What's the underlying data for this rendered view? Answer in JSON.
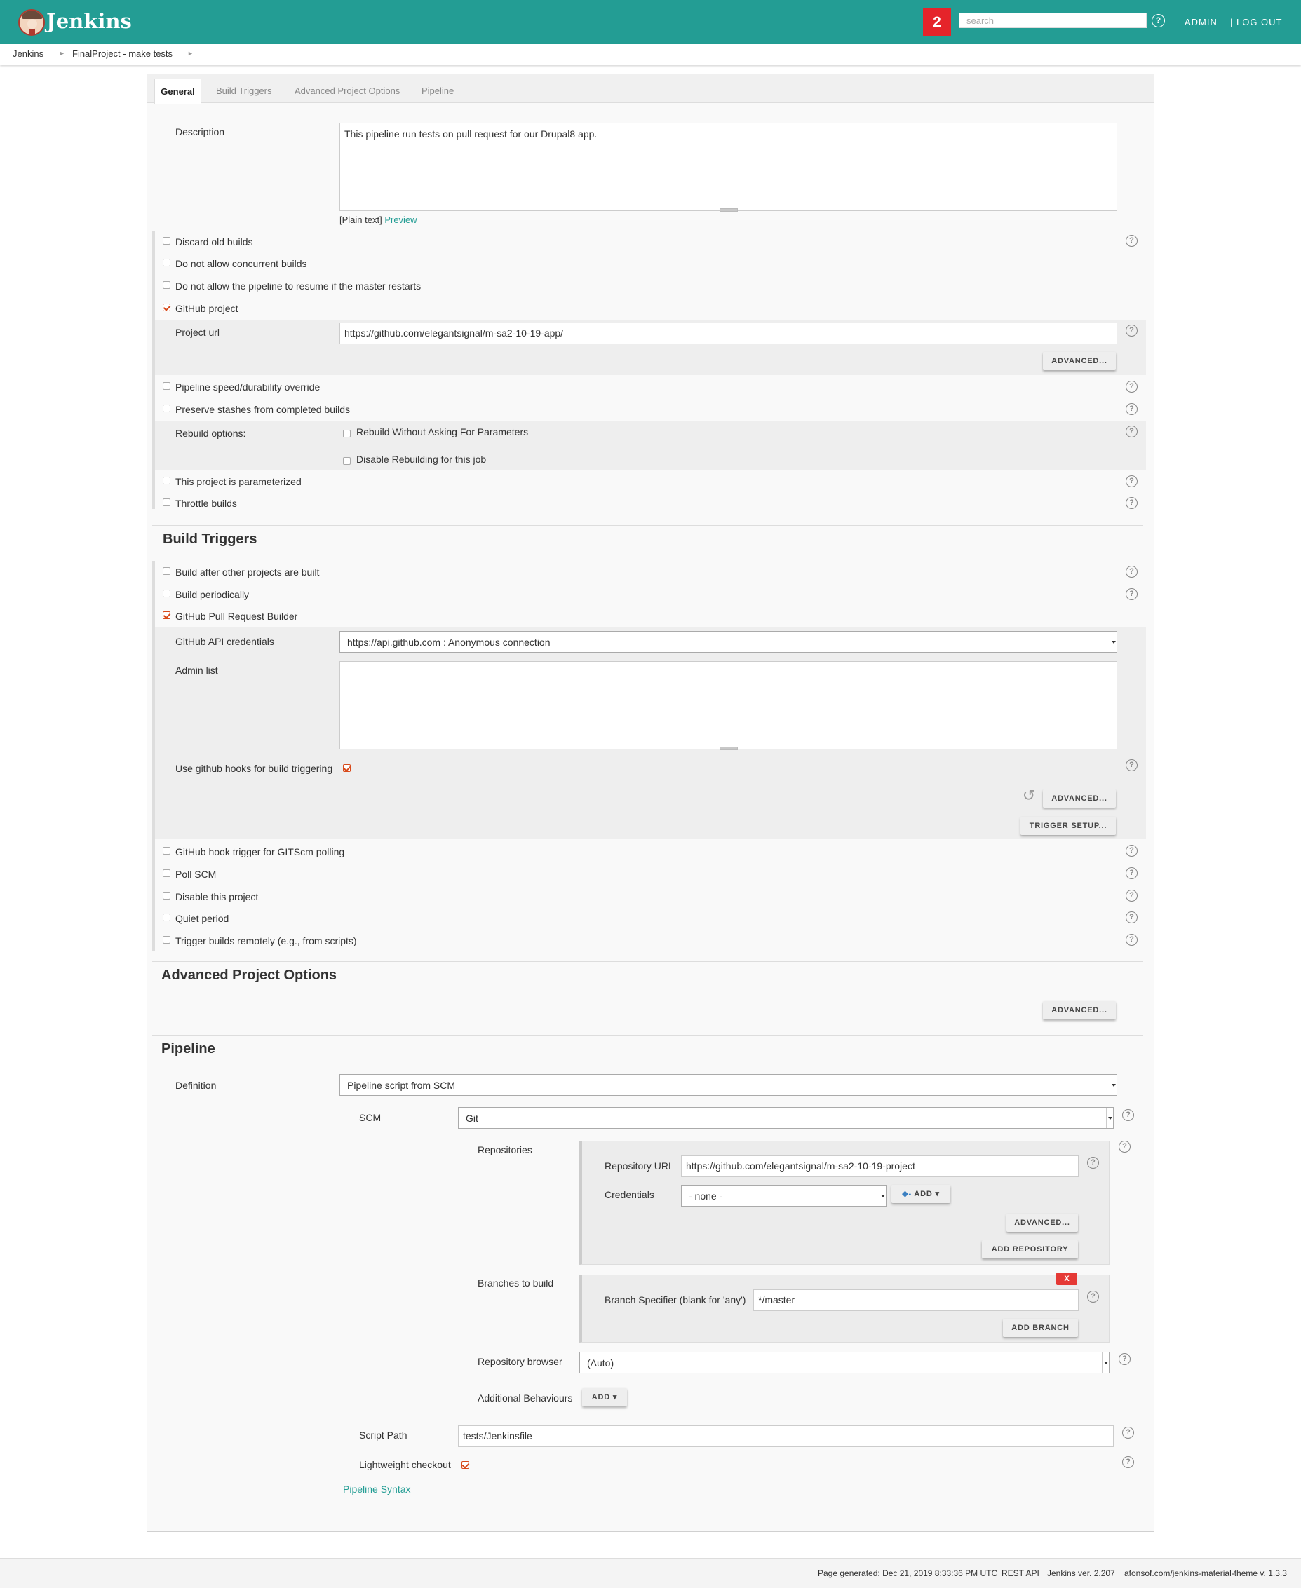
{
  "header": {
    "brand": "Jenkins",
    "alert_count": "2",
    "search_placeholder": "search",
    "help": "?",
    "admin": "ADMIN",
    "logout": "| LOG OUT"
  },
  "breadcrumb": [
    "Jenkins",
    "FinalProject - make tests"
  ],
  "tabs": [
    "General",
    "Build Triggers",
    "Advanced Project Options",
    "Pipeline"
  ],
  "general": {
    "description_label": "Description",
    "description_value": "This pipeline run tests on pull request for our Drupal8 app.",
    "plain_text": "[Plain text]",
    "preview": "Preview",
    "discard_old": "Discard old builds",
    "no_concurrent": "Do not allow concurrent builds",
    "no_resume": "Do not allow the pipeline to resume if the master restarts",
    "github_project": "GitHub project",
    "project_url_label": "Project url",
    "project_url_value": "https://github.com/elegantsignal/m-sa2-10-19-app/",
    "advanced": "ADVANCED...",
    "speed_override": "Pipeline speed/durability override",
    "preserve_stashes": "Preserve stashes from completed builds",
    "rebuild_options": "Rebuild options:",
    "rebuild_without": "Rebuild Without Asking For Parameters",
    "disable_rebuild": "Disable Rebuilding for this job",
    "parameterized": "This project is parameterized",
    "throttle": "Throttle builds"
  },
  "triggers": {
    "title": "Build Triggers",
    "after_other": "Build after other projects are built",
    "periodically": "Build periodically",
    "ghprb": "GitHub Pull Request Builder",
    "api_creds_label": "GitHub API credentials",
    "api_creds_value": "https://api.github.com : Anonymous connection",
    "admin_list": "Admin list",
    "use_hooks": "Use github hooks for build triggering",
    "advanced": "ADVANCED...",
    "trigger_setup": "TRIGGER SETUP...",
    "gitscm": "GitHub hook trigger for GITScm polling",
    "poll_scm": "Poll SCM",
    "disable": "Disable this project",
    "quiet": "Quiet period",
    "remote": "Trigger builds remotely (e.g., from scripts)"
  },
  "advanced_options": {
    "title": "Advanced Project Options",
    "advanced": "ADVANCED..."
  },
  "pipeline": {
    "title": "Pipeline",
    "definition_label": "Definition",
    "definition_value": "Pipeline script from SCM",
    "scm_label": "SCM",
    "scm_value": "Git",
    "repositories_label": "Repositories",
    "repo_url_label": "Repository URL",
    "repo_url_value": "https://github.com/elegantsignal/m-sa2-10-19-project",
    "credentials_label": "Credentials",
    "credentials_value": "- none -",
    "add": "ADD",
    "advanced": "ADVANCED...",
    "add_repository": "ADD REPOSITORY",
    "branches_label": "Branches to build",
    "delete_x": "X",
    "branch_spec_label": "Branch Specifier (blank for 'any')",
    "branch_spec_value": "*/master",
    "add_branch": "ADD BRANCH",
    "repo_browser_label": "Repository browser",
    "repo_browser_value": "(Auto)",
    "additional_label": "Additional Behaviours",
    "script_path_label": "Script Path",
    "script_path_value": "tests/Jenkinsfile",
    "lightweight": "Lightweight checkout",
    "syntax": "Pipeline Syntax"
  },
  "footer": {
    "generated": "Page generated: Dec 21, 2019 8:33:36 PM UTC",
    "rest_api": "REST API",
    "version": "Jenkins ver. 2.207",
    "theme": "afonsof.com/jenkins-material-theme v. 1.3.3"
  },
  "colors": {
    "header": "#239d94",
    "accent": "#239d94",
    "alert": "#e5242a",
    "check": "#d84a1b"
  }
}
